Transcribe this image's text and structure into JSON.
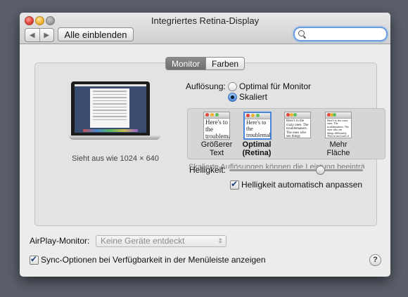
{
  "window": {
    "title": "Integriertes Retina-Display"
  },
  "toolbar": {
    "back": "◀",
    "forward": "▶",
    "show_all": "Alle einblenden",
    "search_placeholder": ""
  },
  "tabs": [
    {
      "label": "Monitor",
      "selected": true
    },
    {
      "label": "Farben",
      "selected": false
    }
  ],
  "display_preview": {
    "resolution_note": "Sieht aus wie 1024 × 640"
  },
  "resolution": {
    "label": "Auflösung:",
    "options": [
      {
        "label": "Optimal für Monitor",
        "selected": false
      },
      {
        "label": "Skaliert",
        "selected": true
      }
    ],
    "scaled_choices": [
      {
        "caption1": "Größerer",
        "caption2": "Text",
        "sample": "Here's to the troublemakers.",
        "selected": false
      },
      {
        "caption1": "Optimal",
        "caption2": "(Retina)",
        "sample": "Here's to the troublemakers. ones who see",
        "selected": true
      },
      {
        "caption1": "",
        "caption2": "",
        "sample": "Here's to the crazy ones. The troublemakers. The ones who see things differently. They're not fond of rules. And they",
        "selected": false
      },
      {
        "caption1": "Mehr",
        "caption2": "Fläche",
        "sample": "Here's to the crazy ones. The troublemakers. The ones who see things differently. They're not fond of rules. And they have no respect for the status quo. You can quote them, disagree with them, glorify or vilify them.",
        "selected": false
      }
    ],
    "faded_note": "Skalierte Auflösungen können die Leistung beeinträchtigen"
  },
  "brightness": {
    "label": "Helligkeit:",
    "level": 0.68,
    "auto_label": "Helligkeit automatisch anpassen",
    "auto_checked": true
  },
  "airplay": {
    "label": "AirPlay-Monitor:",
    "value": "Keine Geräte entdeckt"
  },
  "sync": {
    "label": "Sync-Optionen bei Verfügbarkeit in der Menüleiste anzeigen",
    "checked": true
  },
  "help": "?"
}
